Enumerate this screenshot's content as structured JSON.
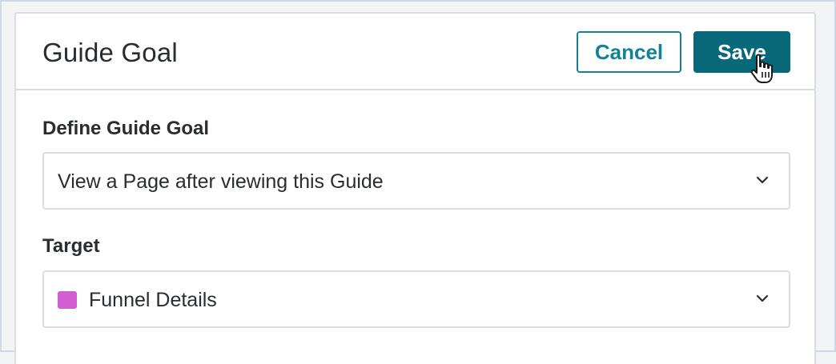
{
  "header": {
    "title": "Guide Goal",
    "cancel_label": "Cancel",
    "save_label": "Save"
  },
  "goal": {
    "label": "Define Guide Goal",
    "selected_value": "View a Page after viewing this Guide"
  },
  "target": {
    "label": "Target",
    "selected_value": "Funnel Details",
    "swatch_color": "#d15fd1"
  },
  "colors": {
    "primary": "#07687a",
    "primary_outline": "#128297",
    "border": "#dadce5",
    "text": "#2a2c35",
    "background": "#f3f4f6"
  },
  "icons": {
    "dropdown": "chevron-down-icon",
    "cursor": "hand-pointer-cursor"
  }
}
